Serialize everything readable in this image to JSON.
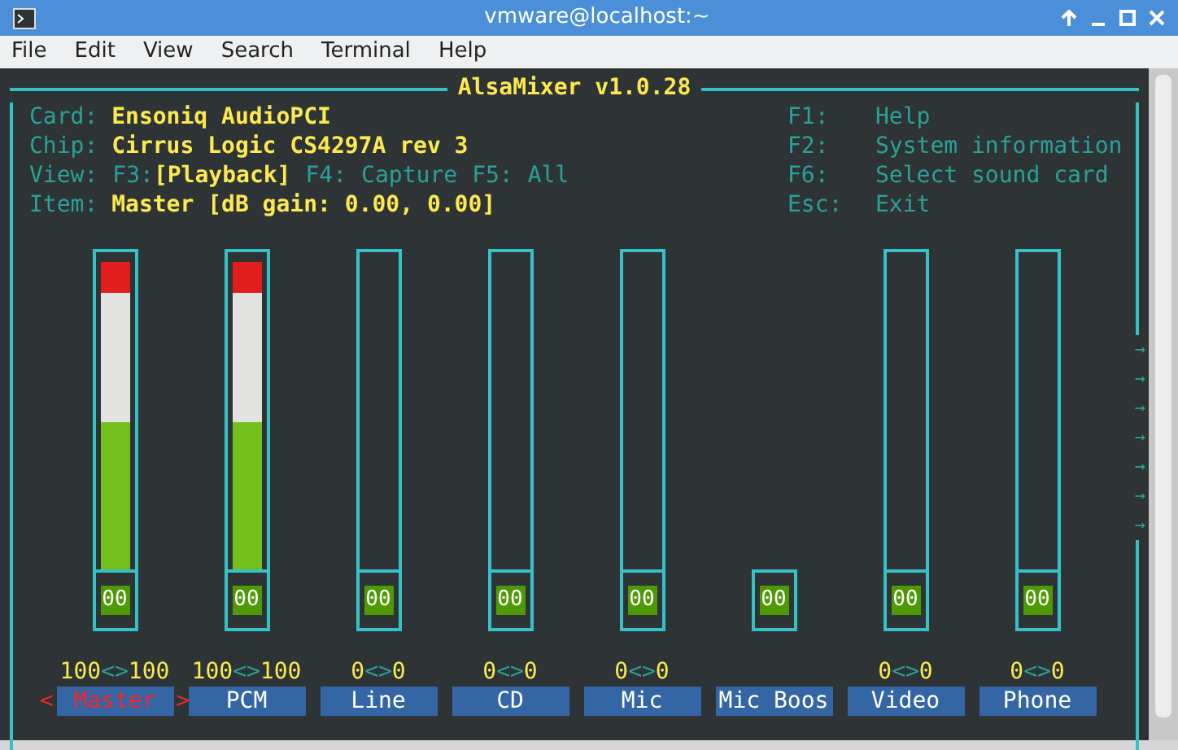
{
  "window": {
    "title": "vmware@localhost:~"
  },
  "menu": [
    "File",
    "Edit",
    "View",
    "Search",
    "Terminal",
    "Help"
  ],
  "mixer": {
    "title": "AlsaMixer v1.0.28",
    "info": [
      {
        "label": "Card:",
        "value": "Ensoniq AudioPCI"
      },
      {
        "label": "Chip:",
        "value": "Cirrus Logic CS4297A rev 3"
      }
    ],
    "view": {
      "label": "View:",
      "options": [
        {
          "key": "F3:",
          "name": "[Playback]",
          "selected": true
        },
        {
          "key": "F4:",
          "name": "Capture",
          "selected": false
        },
        {
          "key": "F5:",
          "name": "All",
          "selected": false
        }
      ]
    },
    "item": {
      "label": "Item:",
      "value": "Master [dB gain: 0.00, 0.00]"
    },
    "keys": [
      {
        "key": "F1:",
        "action": "Help"
      },
      {
        "key": "F2:",
        "action": "System information"
      },
      {
        "key": "F6:",
        "action": "Select sound card"
      },
      {
        "key": "Esc:",
        "action": "Exit"
      }
    ],
    "selection_marks": [
      "<",
      ">"
    ],
    "edge_marks": [
      "→",
      "→",
      "→",
      "→",
      "→",
      "→",
      "→"
    ],
    "channels": [
      {
        "name": "Master",
        "kind": "volume",
        "level": 1,
        "values": [
          "100",
          "100"
        ],
        "separator": "<>",
        "switch": "00",
        "muted": false,
        "selected": true
      },
      {
        "name": "PCM",
        "kind": "volume",
        "level": 1,
        "values": [
          "100",
          "100"
        ],
        "separator": "<>",
        "switch": "00",
        "muted": false,
        "selected": false
      },
      {
        "name": "Line",
        "kind": "volume",
        "level": 0,
        "values": [
          "0",
          "0"
        ],
        "separator": "<>",
        "switch": "00",
        "muted": false,
        "selected": false
      },
      {
        "name": "CD",
        "kind": "volume",
        "level": 0,
        "values": [
          "0",
          "0"
        ],
        "separator": "<>",
        "switch": "00",
        "muted": false,
        "selected": false
      },
      {
        "name": "Mic",
        "kind": "volume",
        "level": 0,
        "values": [
          "0",
          "0"
        ],
        "separator": "<>",
        "switch": "00",
        "muted": false,
        "selected": false
      },
      {
        "name": "Mic Boos",
        "kind": "switch",
        "switch": "00",
        "muted": false,
        "selected": false
      },
      {
        "name": "Video",
        "kind": "volume",
        "level": 0,
        "values": [
          "0",
          "0"
        ],
        "separator": "<>",
        "switch": "00",
        "muted": false,
        "selected": false
      },
      {
        "name": "Phone",
        "kind": "volume",
        "level": 0,
        "values": [
          "0",
          "0"
        ],
        "separator": "<>",
        "switch": "00",
        "muted": false,
        "selected": false
      }
    ]
  }
}
